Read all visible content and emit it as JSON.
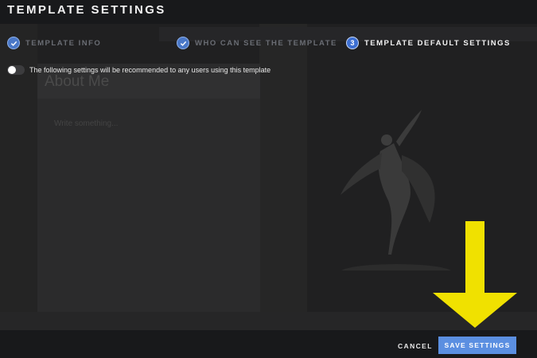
{
  "header": {
    "title": "TEMPLATE SETTINGS"
  },
  "background": {
    "ghost_title": "About Me",
    "ghost_line": "Write something..."
  },
  "steps": [
    {
      "label": "TEMPLATE INFO",
      "status": "done",
      "icon": "check-icon"
    },
    {
      "label": "WHO CAN SEE THE TEMPLATE",
      "status": "done",
      "icon": "check-icon"
    },
    {
      "label": "TEMPLATE DEFAULT SETTINGS",
      "status": "current",
      "number": "3"
    }
  ],
  "toggle": {
    "label": "The following settings will be recommended to any users using this template",
    "on": false
  },
  "footer": {
    "cancel_label": "CANCEL",
    "save_label": "SAVE SETTINGS"
  },
  "annotation": {
    "icon": "down-arrow-icon",
    "color": "#f0e100"
  },
  "colors": {
    "accent": "#5b8fe1",
    "step_done": "#4a78c8"
  }
}
